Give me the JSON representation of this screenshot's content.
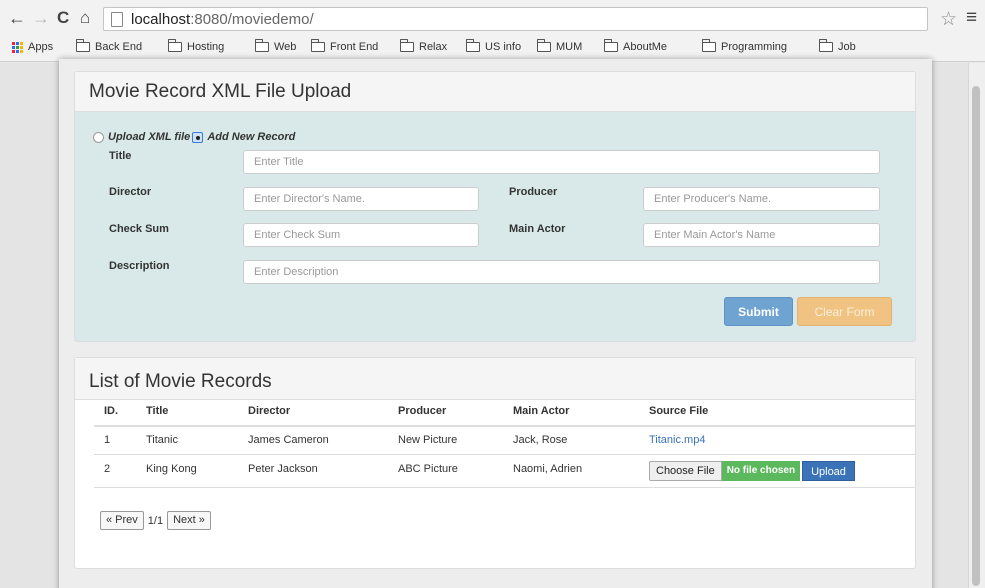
{
  "browser": {
    "back_icon": "←",
    "forward_icon": "→",
    "reload_icon": "C",
    "home_icon": "⌂",
    "url_host": "localhost",
    "url_rest": ":8080/moviedemo/",
    "star_icon": "☆",
    "menu_icon": "≡",
    "bookmarks": [
      "Apps",
      "Back End",
      "Hosting",
      "Web",
      "Front End",
      "Relax",
      "US info",
      "MUM",
      "AboutMe",
      "Programming",
      "Job"
    ]
  },
  "upload_panel": {
    "title": "Movie Record XML File Upload",
    "radio_upload_label": "Upload XML file",
    "radio_add_label": "Add New Record",
    "selected_mode": "Add New Record",
    "fields": {
      "title": {
        "label": "Title",
        "placeholder": "Enter Title",
        "value": ""
      },
      "director": {
        "label": "Director",
        "placeholder": "Enter Director's Name.",
        "value": ""
      },
      "producer": {
        "label": "Producer",
        "placeholder": "Enter Producer's Name.",
        "value": ""
      },
      "checksum": {
        "label": "Check Sum",
        "placeholder": "Enter Check Sum",
        "value": ""
      },
      "main_actor": {
        "label": "Main Actor",
        "placeholder": "Enter Main Actor's Name",
        "value": ""
      },
      "description": {
        "label": "Description",
        "placeholder": "Enter Description",
        "value": ""
      }
    },
    "submit_label": "Submit",
    "clear_label": "Clear Form"
  },
  "list_panel": {
    "title": "List of Movie Records",
    "columns": [
      "ID.",
      "Title",
      "Director",
      "Producer",
      "Main Actor",
      "Source File"
    ],
    "rows": [
      {
        "id": "1",
        "title": "Titanic",
        "director": "James Cameron",
        "producer": "New Picture",
        "main_actor": "Jack, Rose",
        "source_file": "Titanic.mp4"
      },
      {
        "id": "2",
        "title": "King Kong",
        "director": "Peter Jackson",
        "producer": "ABC Picture",
        "main_actor": "Naomi, Adrien",
        "choose_file_label": "Choose File",
        "no_file_label": "No file chosen",
        "upload_label": "Upload"
      }
    ],
    "pager": {
      "prev_label": "« Prev",
      "page_info": "1/1",
      "next_label": "Next »"
    }
  },
  "colors": {
    "form_bg": "#d9e9e9",
    "submit": "#6fa3d1",
    "clear": "#f0c382",
    "no_file": "#5cb85c",
    "upload": "#3a73b8",
    "link": "#3a73b8"
  }
}
